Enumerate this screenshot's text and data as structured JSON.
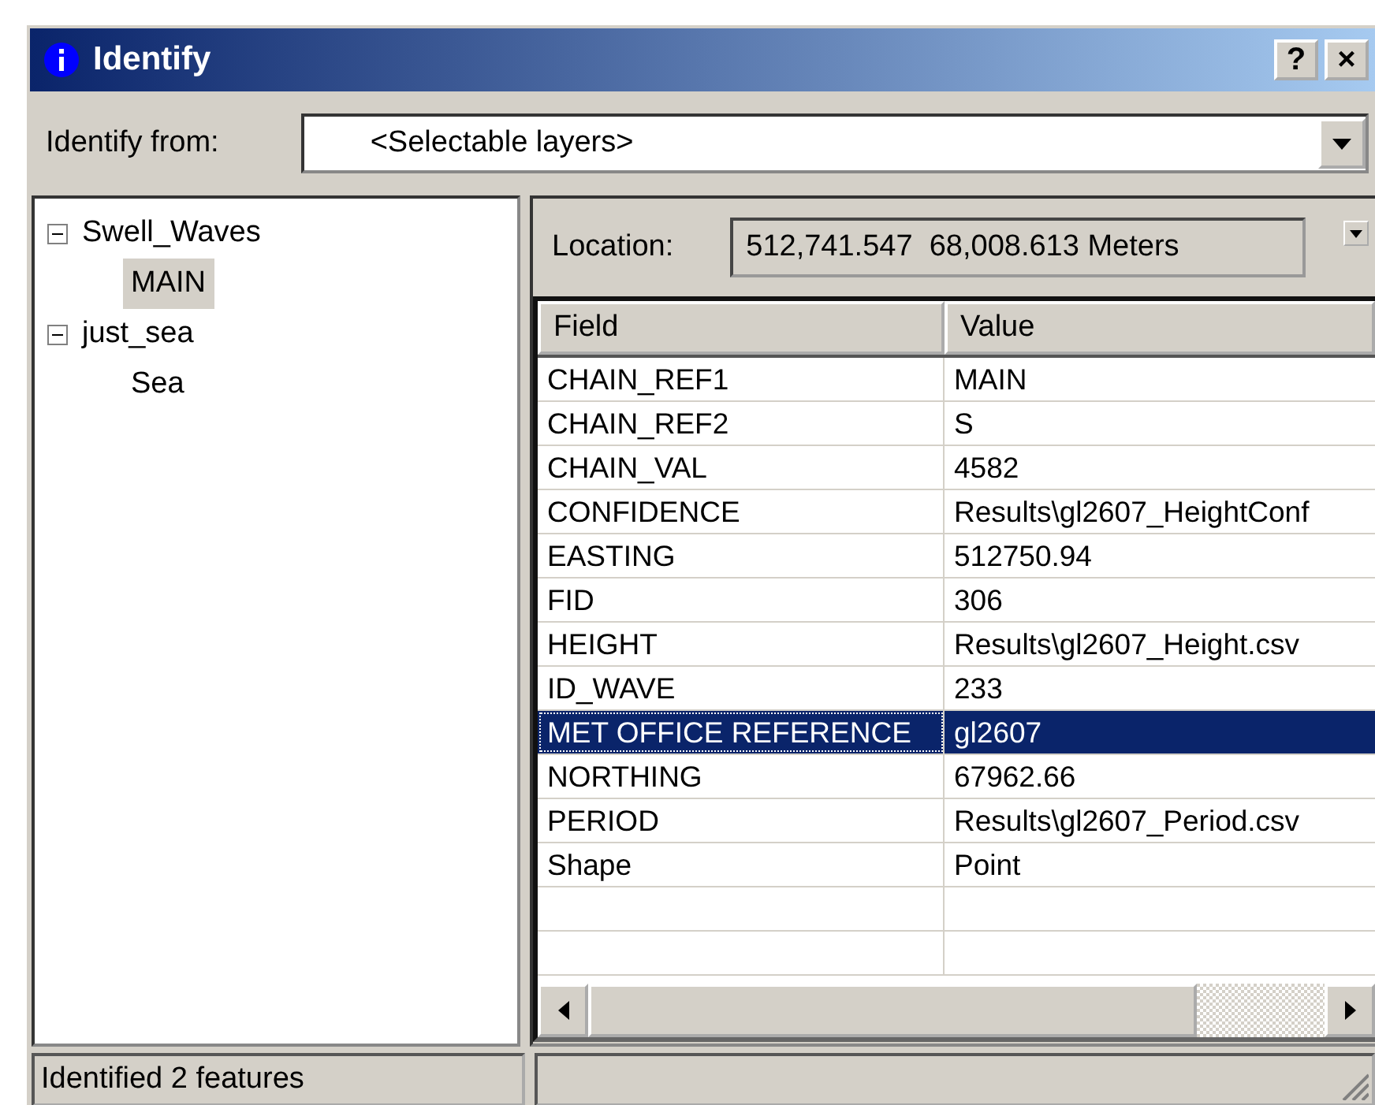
{
  "window": {
    "title": "Identify",
    "buttons": [
      "?",
      "×"
    ]
  },
  "identify_from": {
    "label": "Identify from:",
    "value": "<Selectable layers>"
  },
  "tree": [
    {
      "label": "Swell_Waves",
      "expanded": true,
      "selected": false,
      "children": [
        {
          "label": "MAIN",
          "selected": true
        }
      ]
    },
    {
      "label": "just_sea",
      "expanded": true,
      "selected": false,
      "children": [
        {
          "label": "Sea",
          "selected": false
        }
      ]
    }
  ],
  "location": {
    "label": "Location:",
    "value": "512,741.547  68,008.613 Meters"
  },
  "table": {
    "columns": [
      "Field",
      "Value"
    ],
    "rows": [
      {
        "field": "CHAIN_REF1",
        "value": "MAIN",
        "selected": false
      },
      {
        "field": "CHAIN_REF2",
        "value": "S",
        "selected": false
      },
      {
        "field": "CHAIN_VAL",
        "value": "4582",
        "selected": false
      },
      {
        "field": "CONFIDENCE",
        "value": "Results\\gl2607_HeightConf",
        "selected": false
      },
      {
        "field": "EASTING",
        "value": "512750.94",
        "selected": false
      },
      {
        "field": "FID",
        "value": "306",
        "selected": false
      },
      {
        "field": "HEIGHT",
        "value": "Results\\gl2607_Height.csv",
        "selected": false
      },
      {
        "field": "ID_WAVE",
        "value": "233",
        "selected": false
      },
      {
        "field": "MET OFFICE REFERENCE",
        "value": "gl2607",
        "selected": true
      },
      {
        "field": "NORTHING",
        "value": "67962.66",
        "selected": false
      },
      {
        "field": "PERIOD",
        "value": "Results\\gl2607_Period.csv",
        "selected": false
      },
      {
        "field": "Shape",
        "value": "Point",
        "selected": false
      }
    ]
  },
  "status_bar": "Identified 2 features"
}
